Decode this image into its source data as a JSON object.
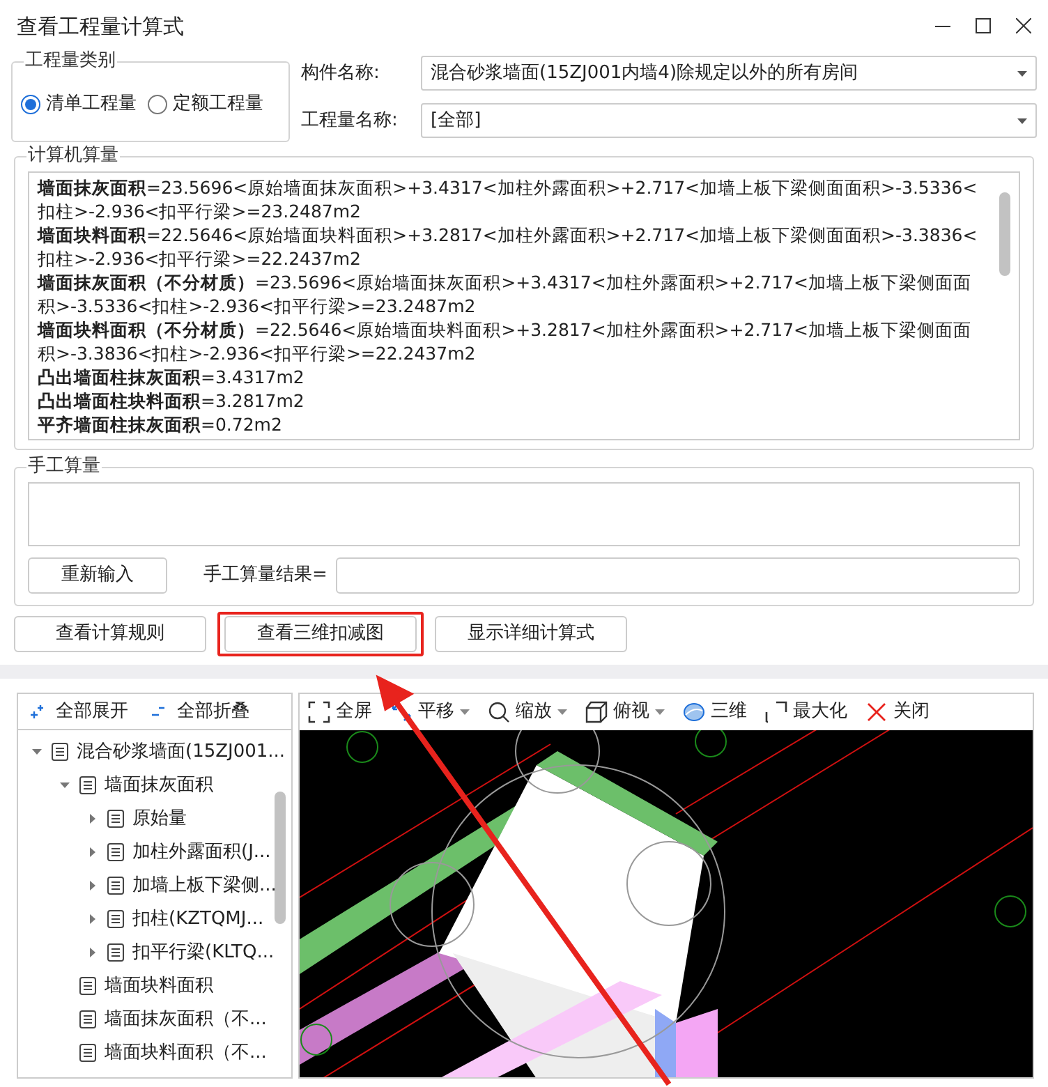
{
  "window": {
    "title": "查看工程量计算式"
  },
  "quantity_type": {
    "legend": "工程量类别",
    "options": [
      {
        "label": "清单工程量",
        "selected": true
      },
      {
        "label": "定额工程量",
        "selected": false
      }
    ]
  },
  "fields": [
    {
      "label": "构件名称:",
      "value": "混合砂浆墙面(15ZJ001内墙4)除规定以外的所有房间"
    },
    {
      "label": "工程量名称:",
      "value": "[全部]"
    }
  ],
  "computer_calc": {
    "legend": "计算机算量",
    "lines": [
      "**墙面抹灰面积**=23.5696<原始墙面抹灰面积>+3.4317<加柱外露面积>+2.717<加墙上板下梁侧面面积>-3.5336<扣柱>-2.936<扣平行梁>=23.2487m2",
      "**墙面块料面积**=22.5646<原始墙面块料面积>+3.2817<加柱外露面积>+2.717<加墙上板下梁侧面面积>-3.3836<扣柱>-2.936<扣平行梁>=22.2437m2",
      "**墙面抹灰面积（不分材质）**=23.5696<原始墙面抹灰面积>+3.4317<加柱外露面积>+2.717<加墙上板下梁侧面面积>-3.5336<扣柱>-2.936<扣平行梁>=23.2487m2",
      "**墙面块料面积（不分材质）**=22.5646<原始墙面块料面积>+3.2817<加柱外露面积>+2.717<加墙上板下梁侧面面积>-3.3836<扣柱>-2.936<扣平行梁>=22.2437m2",
      "**凸出墙面柱抹灰面积**=3.4317m2",
      "**凸出墙面柱块料面积**=3.2817m2",
      "**平齐墙面柱抹灰面积**=0.72m2"
    ]
  },
  "manual_calc": {
    "legend": "手工算量",
    "reset_button": "重新输入",
    "result_label": "手工算量结果="
  },
  "buttons": [
    {
      "label": "查看计算规则",
      "highlighted": false
    },
    {
      "label": "查看三维扣减图",
      "highlighted": true
    },
    {
      "label": "显示详细计算式",
      "highlighted": false
    }
  ],
  "tree_toolbar": [
    {
      "kind": "expand",
      "label": "全部展开"
    },
    {
      "kind": "collapse",
      "label": "全部折叠"
    }
  ],
  "tree": [
    {
      "label": "混合砂浆墙面(15ZJ001...",
      "expanded": true,
      "children": [
        {
          "label": "墙面抹灰面积",
          "expanded": true,
          "children": [
            {
              "label": "原始量",
              "expanded": false
            },
            {
              "label": "加柱外露面积(J...",
              "expanded": false
            },
            {
              "label": "加墙上板下梁侧...",
              "expanded": false
            },
            {
              "label": "扣柱(KZTQMJ...",
              "expanded": false
            },
            {
              "label": "扣平行梁(KLTQ...",
              "expanded": false
            }
          ]
        },
        {
          "label": "墙面块料面积"
        },
        {
          "label": "墙面抹灰面积（不..."
        },
        {
          "label": "墙面块料面积（不..."
        }
      ]
    }
  ],
  "viewer_toolbar": [
    {
      "kind": "fullscreen",
      "label": "全屏",
      "dropdown": false
    },
    {
      "kind": "pan",
      "label": "平移",
      "dropdown": true
    },
    {
      "kind": "zoom",
      "label": "缩放",
      "dropdown": true
    },
    {
      "kind": "top",
      "label": "俯视",
      "dropdown": true
    },
    {
      "kind": "orbit",
      "label": "三维",
      "dropdown": false
    },
    {
      "kind": "maximize",
      "label": "最大化",
      "dropdown": false
    },
    {
      "kind": "close",
      "label": "关闭",
      "dropdown": false
    }
  ]
}
